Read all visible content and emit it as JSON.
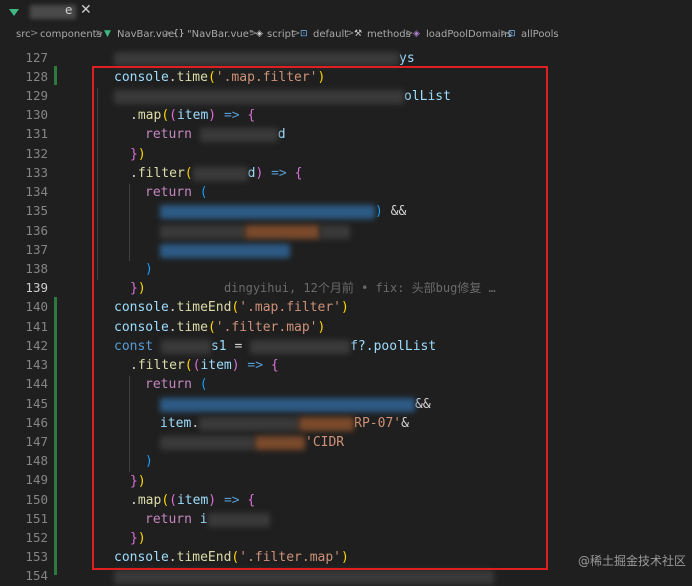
{
  "tab": {
    "suffix": "e",
    "close_glyph": "✕"
  },
  "breadcrumb": {
    "items": [
      "src",
      "components",
      "NavBar.vue",
      "\"NavBar.vue\"",
      "script",
      "default",
      "methods",
      "loadPoolDomains",
      "allPools"
    ],
    "separator": ">"
  },
  "editor": {
    "line_numbers": [
      "127",
      "128",
      "129",
      "130",
      "131",
      "132",
      "133",
      "134",
      "135",
      "136",
      "137",
      "138",
      "139",
      "140",
      "141",
      "142",
      "143",
      "144",
      "145",
      "146",
      "147",
      "148",
      "149",
      "150",
      "151",
      "152",
      "153",
      "154"
    ],
    "current_line": "139",
    "fragments": {
      "l127_tail": "ys",
      "console": "console",
      "time": "time",
      "timeEnd": "timeEnd",
      "str_map_filter": "'.map.filter'",
      "str_filter_map": "'.filter.map'",
      "poolList_tail": "olList",
      "map": "map",
      "filter": "filter",
      "item": "item",
      "return": "return",
      "d_tail": "d",
      "arrow": "=>",
      "and": "&&",
      "const": "const",
      "s1": "s1",
      "eq": "=",
      "f_tail": "f?.poolList",
      "rp07": "RP-07",
      "rp_short": "RP-0",
      "cidr_tail": "CIDR",
      "item_i": "i",
      "blame": "dingyihui, 12个月前 • fix: 头部bug修复 …"
    }
  },
  "watermark": "@稀土掘金技术社区",
  "colors": {
    "background": "#1f1f1f",
    "highlight_box": "#e02020",
    "keyword": "#569cd6",
    "function": "#dcdcaa",
    "string": "#ce9178",
    "variable": "#9cdcfe"
  }
}
